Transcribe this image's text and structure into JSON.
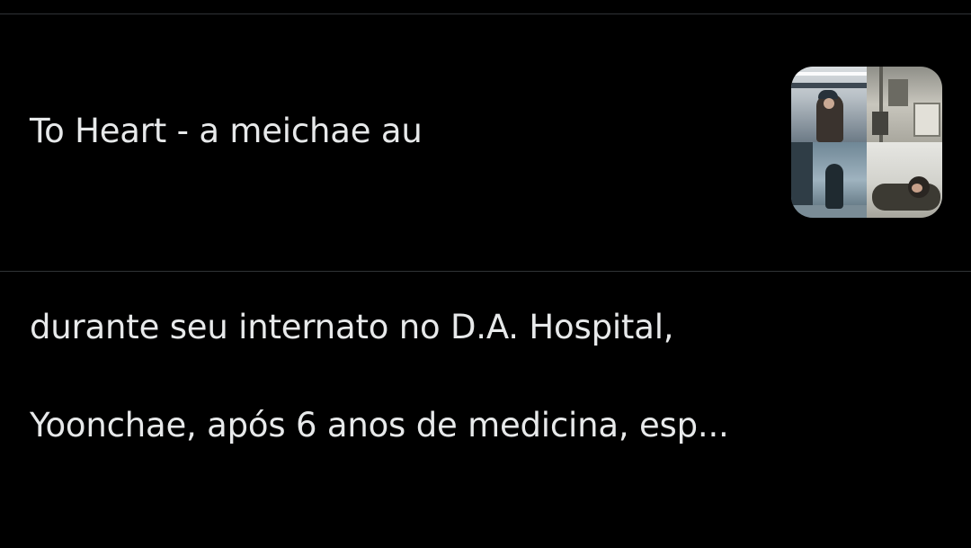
{
  "card": {
    "title": "To Heart - a meichae au",
    "description_line1": "durante seu internato no D.A. Hospital,",
    "description_line2": "Yoonchae, após 6 anos de medicina, esp..."
  },
  "thumbnail": {
    "tiles": [
      "subway-photo",
      "hospital-equipment-photo",
      "hallway-photo",
      "resting-person-photo"
    ]
  },
  "colors": {
    "background": "#000000",
    "text": "#e7e9ea",
    "divider": "#2f3336"
  }
}
